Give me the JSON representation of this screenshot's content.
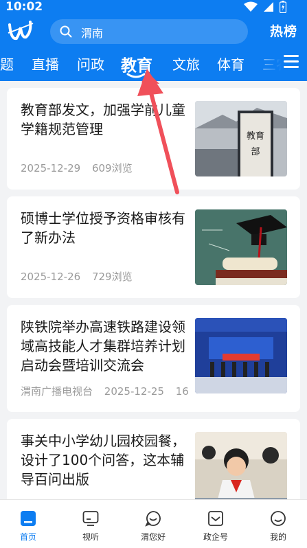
{
  "status": {
    "time": "10:02"
  },
  "search": {
    "query": "渭南"
  },
  "header": {
    "hot_label": "热榜"
  },
  "tabs": [
    {
      "label": "题"
    },
    {
      "label": "直播"
    },
    {
      "label": "问政"
    },
    {
      "label": "教育"
    },
    {
      "label": "文旅"
    },
    {
      "label": "体育"
    },
    {
      "label": "三农"
    }
  ],
  "active_tab": "教育",
  "articles": [
    {
      "title": "教育部发文，加强学前儿童学籍规范管理",
      "date": "2025-12-29",
      "views": "609浏览",
      "source": "",
      "image": "ministry-of-education-sign-image"
    },
    {
      "title": "硕博士学位授予资格审核有了新办法",
      "date": "2025-12-26",
      "views": "729浏览",
      "source": "",
      "image": "graduation-cap-diploma-image"
    },
    {
      "title": "陕铁院举办高速铁路建设领域高技能人才集群培养计划启动会暨培训交流会",
      "date": "2025-12-25",
      "views": "16",
      "source": "渭南广播电视台",
      "image": "launch-ceremony-image"
    },
    {
      "title": "事关中小学幼儿园校园餐，设计了100个问答，这本辅导百问出版",
      "date": "",
      "views": "",
      "source": "",
      "image": "students-eating-lunch-image"
    }
  ],
  "bottom_nav": [
    {
      "label": "首页",
      "icon": "home-icon"
    },
    {
      "label": "视听",
      "icon": "tv-icon"
    },
    {
      "label": "渭您好",
      "icon": "chat-icon"
    },
    {
      "label": "政企号",
      "icon": "mail-icon"
    },
    {
      "label": "我的",
      "icon": "profile-icon"
    }
  ],
  "colors": {
    "brand": "#0d7df1",
    "annotation_arrow": "#f0505a"
  }
}
